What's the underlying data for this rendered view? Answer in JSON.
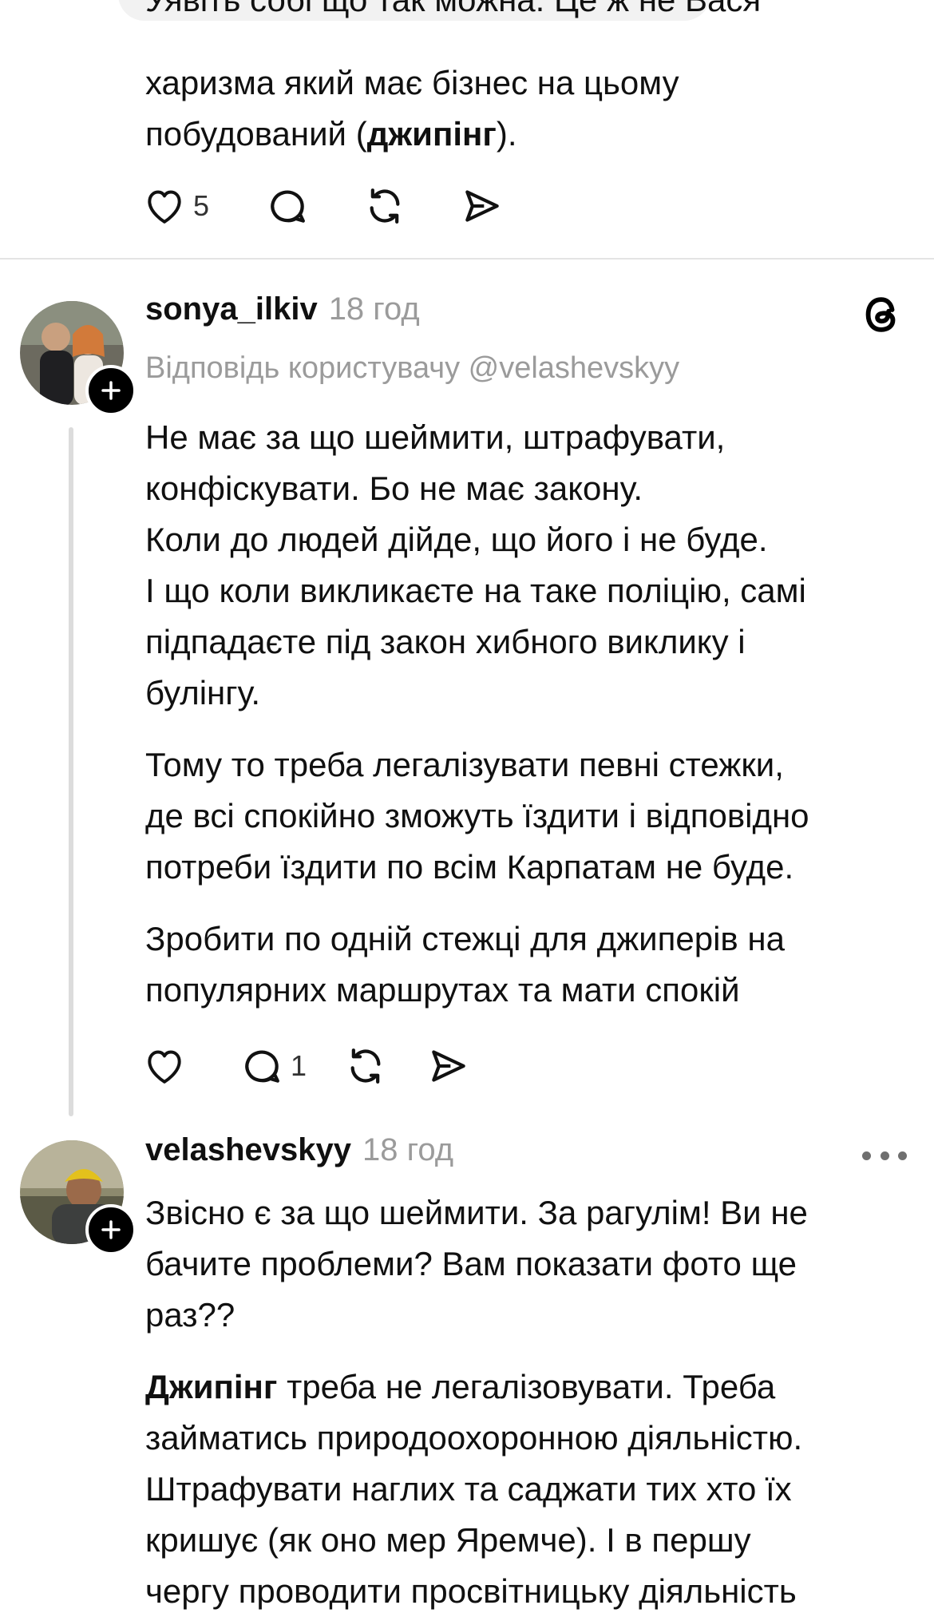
{
  "post_top": {
    "cut_line": "Уявіть собі що так можна. Це ж не Вася",
    "lines": [
      "харизма який має бізнес на цьому",
      "побудований ("
    ],
    "bold_word": "джипінг",
    "tail": ")."
  },
  "post_top_actions": {
    "like_count": "5"
  },
  "reply_1": {
    "username": "sonya_ilkiv",
    "time": "18 год",
    "reply_to": "Відповідь користувачу @velashevskyy",
    "paragraphs": [
      [
        "Не має за що шеймити, штрафувати,",
        "конфіскувати. Бо не має закону."
      ],
      [
        "Коли до людей дійде, що його і не буде."
      ],
      [
        "І що коли викликаєте на таке поліцію, самі",
        "підпадаєте під закон хибного виклику і",
        "булінгу."
      ],
      [
        "Тому то треба легалізувати певні стежки,",
        "де всі спокійно зможуть їздити і відповідно",
        "потреби їздити по всім Карпатам не буде."
      ],
      [
        "Зробити по одній стежці для джиперів на",
        "популярних маршрутах та мати спокій"
      ]
    ],
    "reply_count": "1"
  },
  "reply_2": {
    "username": "velashevskyy",
    "time": "18 год",
    "para1": [
      "Звісно є за що шеймити. За рагулім! Ви не",
      "бачите проблеми? Вам показати фото ще",
      "раз??"
    ],
    "para2_bold": "Джипінг",
    "para2_first_rest": " треба не легалізовувати. Треба",
    "para2_lines": [
      "займатись природоохоронною діяльністю.",
      "Штрафувати наглих та саджати тих хто їх",
      "кришує (як оно мер Яремче). І в першу",
      "чергу проводити просвітницьку діяльність"
    ]
  },
  "icons": {
    "like": "heart-icon",
    "comment": "comment-icon",
    "repost": "repost-icon",
    "share": "send-icon",
    "threads": "threads-logo-icon",
    "more": "more-dots-icon",
    "follow": "plus-icon"
  },
  "colors": {
    "text": "#101010",
    "muted": "#9b9b9b",
    "divider": "#e4e4e4",
    "thread_line": "#dcdcdc"
  }
}
